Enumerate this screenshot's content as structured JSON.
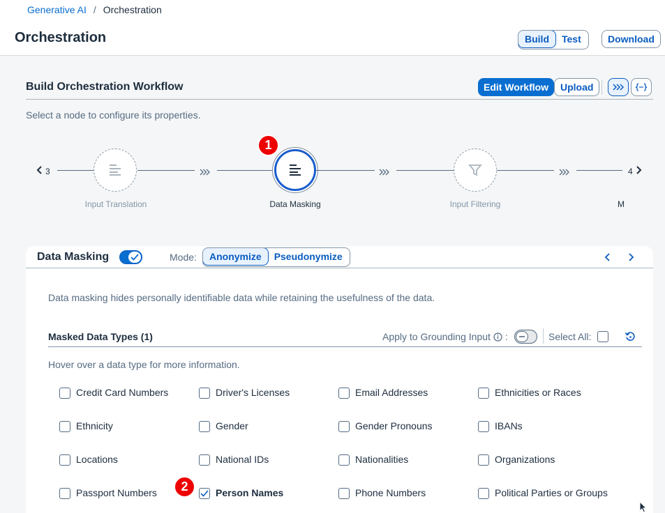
{
  "breadcrumb": {
    "root": "Generative AI",
    "separator": "/",
    "current": "Orchestration"
  },
  "header": {
    "title": "Orchestration",
    "mode_build": "Build",
    "mode_test": "Test",
    "download": "Download"
  },
  "workflow": {
    "title": "Build Orchestration Workflow",
    "edit_workflow": "Edit Workflow",
    "upload": "Upload",
    "hint": "Select a node to configure its properties.",
    "prev_count": "3",
    "next_count": "4",
    "nodes": [
      {
        "label": "Input Translation",
        "active": false
      },
      {
        "label": "Data Masking",
        "active": true
      },
      {
        "label": "Input Filtering",
        "active": false
      },
      {
        "label": "M",
        "active": false
      }
    ],
    "badge_1": "1"
  },
  "panel": {
    "title": "Data Masking",
    "enabled": true,
    "mode_label": "Mode:",
    "mode_anonymize": "Anonymize",
    "mode_pseudonymize": "Pseudonymize",
    "description": "Data masking hides personally identifiable data while retaining the usefulness of the data.",
    "masked_title": "Masked Data Types (1)",
    "apply_label": "Apply to Grounding Input",
    "apply_colon": ":",
    "apply_enabled": false,
    "select_all": "Select All:",
    "hover_hint": "Hover over a data type for more information.",
    "badge_2": "2",
    "data_types": [
      {
        "label": "Credit Card Numbers",
        "checked": false
      },
      {
        "label": "Driver's Licenses",
        "checked": false
      },
      {
        "label": "Email Addresses",
        "checked": false
      },
      {
        "label": "Ethnicities or Races",
        "checked": false
      },
      {
        "label": "Ethnicity",
        "checked": false
      },
      {
        "label": "Gender",
        "checked": false
      },
      {
        "label": "Gender Pronouns",
        "checked": false
      },
      {
        "label": "IBANs",
        "checked": false
      },
      {
        "label": "Locations",
        "checked": false
      },
      {
        "label": "National IDs",
        "checked": false
      },
      {
        "label": "Nationalities",
        "checked": false
      },
      {
        "label": "Organizations",
        "checked": false
      },
      {
        "label": "Passport Numbers",
        "checked": false
      },
      {
        "label": "Person Names",
        "checked": true
      },
      {
        "label": "Phone Numbers",
        "checked": false
      },
      {
        "label": "Political Parties or Groups",
        "checked": false
      }
    ]
  },
  "colors": {
    "accent": "#0a6ed1",
    "badge": "#e00000",
    "text": "#1d2d3e",
    "muted": "#556b82"
  }
}
